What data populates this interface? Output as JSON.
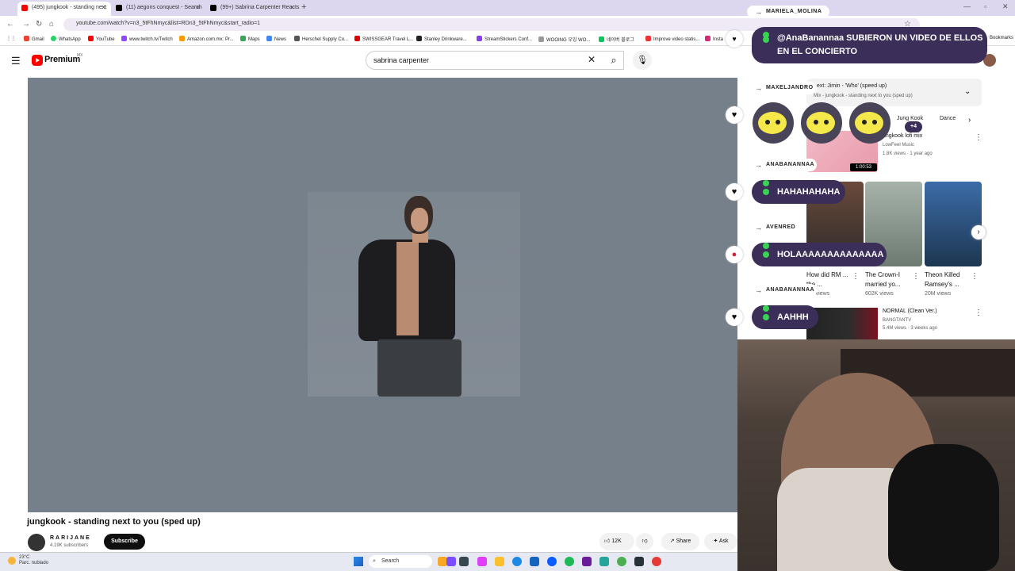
{
  "browser": {
    "tabs": [
      {
        "label": "(495) jungkook - standing next",
        "color": "#ff0000"
      },
      {
        "label": "(11) aegons conquest - Search",
        "color": "#000000"
      },
      {
        "label": "(99+) Sabrina Carpenter Reacts",
        "color": "#000000"
      }
    ],
    "url": "youtube.com/watch?v=n3_5tFhNmyc&list=RDn3_5tFhNmyc&start_radio=1",
    "bookmarks": [
      "Gmail",
      "WhatsApp",
      "YouTube",
      "www.twitch.tv/Twitch",
      "Amazon.com.mx: Pr...",
      "Maps",
      "News",
      "Herschel Supply Co...",
      "SWISSGEAR Travel L...",
      "Stanley Drinkware...",
      "StreamStickers Conf...",
      "WOOING 우잉 WO...",
      "네이버 블로그",
      "Improve video statis...",
      "Insta"
    ],
    "bookmarks_all": "Bookmarks"
  },
  "youtube": {
    "logo_text": "Premium",
    "region": "MX",
    "search_value": "sabrina carpenter",
    "video_title": "jungkook - standing next to you (sped up)",
    "channel_name": "RARIJANE",
    "subscribers": "4.19K subscribers",
    "subscribe_label": "Subscribe",
    "likes": "12K",
    "share_label": "Share",
    "ask_label": "Ask",
    "next_title": "ext: Jimin - 'Who' (speed up)",
    "next_sub": "Mix - jungkook - standing next to you (sped up)",
    "chips": [
      "Jung Kook",
      "Dance"
    ],
    "rec1": {
      "title": "ungkook lofi mix",
      "channel": "LowFeel Music",
      "meta": "1.8K views · 1 year ago",
      "duration": "1:00:53"
    },
    "shorts": [
      {
        "title": "How did RM ... the ...",
        "views": "...4 views"
      },
      {
        "title": "The Crown-I married yo...",
        "views": "602K views"
      },
      {
        "title": "Theon Killed Ramsey's ...",
        "views": "20M views"
      }
    ],
    "rec2": {
      "title": "NORMAL (Clean Ver.)",
      "channel": "BANGTANTV",
      "meta": "5.4M views · 3 weeks ago"
    }
  },
  "chat": [
    {
      "user": "MARIELA_MOLINA",
      "message": "@AnaBanannaa SUBIERON UN VIDEO DE ELLOS EN EL CONCIERTO"
    },
    {
      "user": "MAXELJANDRO",
      "message": ""
    },
    {
      "user": "ANABANANNAA",
      "message": "HAHAHAHAHA"
    },
    {
      "user": "AVENRED",
      "message": "HOLAAAAAAAAAAAAAA"
    },
    {
      "user": "ANABANANNAA",
      "message": "AAHHH"
    }
  ],
  "emote_extra": "+4",
  "taskbar": {
    "weather_temp": "23°C",
    "weather_desc": "Parc. nublado",
    "search_label": "Search"
  }
}
